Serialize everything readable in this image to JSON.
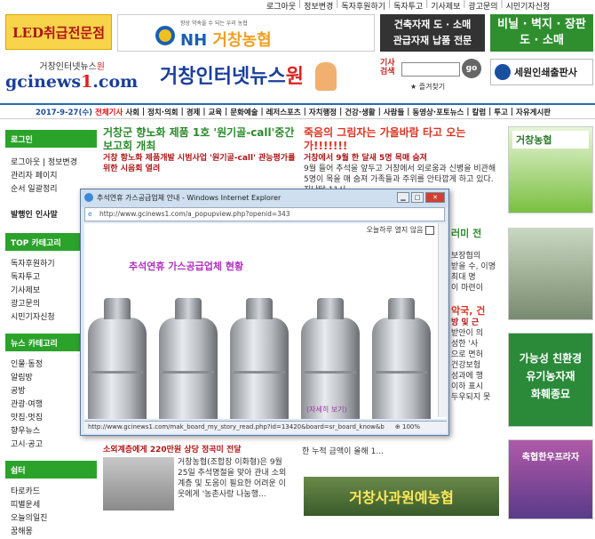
{
  "top_links": [
    "로그아웃",
    "정보변경",
    "독자후원하기",
    "독자투고",
    "기사제보",
    "광고문의",
    "시민기자신청"
  ],
  "ads": {
    "led": "LED취급전문점",
    "nh_small": "향상 약속을 수 되는 우리 농협",
    "nh_logo": "NH",
    "nh_name": "거창농협",
    "building": [
      "건축자재 도 · 소매",
      "관급자재 납품 전문"
    ],
    "vinyl": [
      "비닐 · 벽지 · 장판",
      "도 · 소매"
    ],
    "print": "세원인쇄출판사"
  },
  "site": {
    "logo_kr": "거창인터넷뉴스",
    "logo_kr_em": "원",
    "logo_domain": "gcinews",
    "logo_domain_em": "1",
    "logo_tld": ".com",
    "banner": "거창인터넷뉴스",
    "banner_em": "원"
  },
  "search": {
    "label": "기사검색",
    "button": "go",
    "favorite": "즐겨찾기"
  },
  "nav": {
    "date": "2017-9-27(수)",
    "items": [
      "전체기사",
      "사회",
      "정치·의회",
      "경제",
      "교육",
      "문화예술",
      "레저스포츠",
      "자치행정",
      "건강·생활",
      "사람들",
      "동영상·포토뉴스",
      "칼럼",
      "투고",
      "자유게시판"
    ]
  },
  "sidebar": {
    "login_head": "로그인",
    "login_items": [
      "로그아웃 | 정보변경",
      "관리자 페이지",
      "순서 일괄정리"
    ],
    "issue": "발행인 인사말",
    "top_head": "TOP 카테고리",
    "top_items": [
      "독자후원하기",
      "독자투고",
      "기사제보",
      "광고문의",
      "시민기자신청"
    ],
    "news_head": "뉴스 카테고리",
    "news_items": [
      "인물·동정",
      "알림방",
      "공방",
      "관광·여행",
      "맛집·멋집",
      "향우뉴스",
      "고시·공고"
    ],
    "rest_head": "쉼터",
    "rest_items": [
      "타로카드",
      "띠별운세",
      "오늘의일진",
      "꿈해몽"
    ]
  },
  "articles": {
    "a1_title": "거창군 향노화 제품 1호 '원기골-call'중간보고회 개최",
    "a1_sub": "거창 항노화 제품개발 시범사업 '원기골-call' 관능평가를 위한 시음회 열려",
    "a2_title": "죽음의 그림자는 가을바람 타고 오는가!!!!!!!",
    "a2_sub": "거창에서 9월 한 달새 5명 목매 숨져",
    "a2_body": "9월 들어 추석을 앞두고 거창에서 외로움과 신병을 비관해 5명이 목을 매 숨져 가족들과 주위를 안타깝게 하고 있다. 지난달 11시",
    "a3_title": "소외계층에게 220만원 상당 정곡미 전달",
    "a3_body": "거창농협(조합장 이화형)은 9월 25일 추석명절을 맞아 관내 소외계층 및 도움이 필요한 어려운 이웃에게 '농촌사랑 나눔행...",
    "right_frag": [
      "러미 전",
      "보장협의",
      "받을 수, 이명",
      "최대 명",
      "이 마련이",
      "악국, 건",
      "방 및 근",
      "받안이 의",
      "성한 '사",
      "으로 면허",
      "건강보험",
      "성과에 행",
      "이하 표시",
      "두우되지 못",
      "한 누적 금액이 올해 1..."
    ]
  },
  "right_ads": {
    "nh": "거창농협",
    "eco": [
      "가능성 친환경",
      "유기농자재",
      "화훼종묘"
    ],
    "hanwoo": "축협한우프라자"
  },
  "bottom_banner": "거창사과원예농협",
  "popup": {
    "title": "추석연휴 가스공급업체 안내 - Windows Internet Explorer",
    "url": "http://www.gcinews1.com/a_popupview.php?openid=343",
    "close_check": "오늘하루 열지 않음",
    "heading": "추석연휴 가스공급업체 현황",
    "detail": "(자세히 보기)",
    "status_url": "http://www.gcinews1.com/mak_board_my_story_read.php?id=13420&board=sr_board_know&b",
    "zoom": "100%"
  }
}
